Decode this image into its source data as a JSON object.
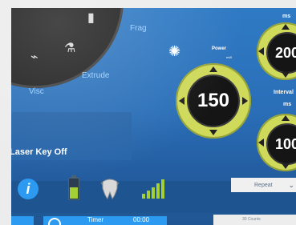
{
  "modes": {
    "frag_label": "Frag",
    "extrude_label": "Extrude",
    "visc_label": "Visc"
  },
  "message": {
    "text": "Laser Key Off"
  },
  "power": {
    "title": "Power",
    "unit": "mW",
    "value": "150"
  },
  "pulse": {
    "unit": "ms",
    "value": "200"
  },
  "interval": {
    "title": "Interval",
    "unit": "ms",
    "value": "100"
  },
  "status": {
    "info_symbol": "i"
  },
  "repeat": {
    "label": "Repeat"
  },
  "timer": {
    "label": "Timer",
    "value": "00:00"
  },
  "counts": {
    "label": "30 Counts"
  },
  "colors": {
    "accent": "#2c9af0",
    "dial": "#cfd95a",
    "battery": "#a4cf35"
  },
  "icons": [
    "laser-icon",
    "info-icon",
    "battery-icon",
    "tooth-icon",
    "signal-icon",
    "tool-icon"
  ]
}
